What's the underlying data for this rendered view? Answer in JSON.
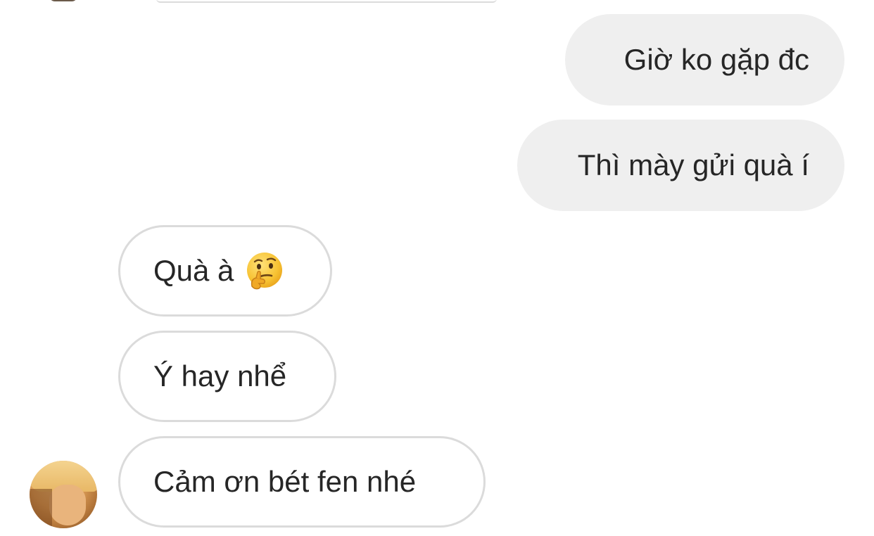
{
  "messages": [
    {
      "direction": "outgoing",
      "text": "Giờ ko gặp đc"
    },
    {
      "direction": "outgoing",
      "text": "Thì mày gửi quà í"
    },
    {
      "direction": "incoming",
      "text": "Quà à",
      "emoji": "thinking-face"
    },
    {
      "direction": "incoming",
      "text": "Ý hay nhể"
    },
    {
      "direction": "incoming",
      "text": "Cảm ơn bét fen nhé"
    }
  ],
  "colors": {
    "outgoing_bubble": "#efefef",
    "incoming_border": "#dbdbdb",
    "text": "#262626"
  }
}
